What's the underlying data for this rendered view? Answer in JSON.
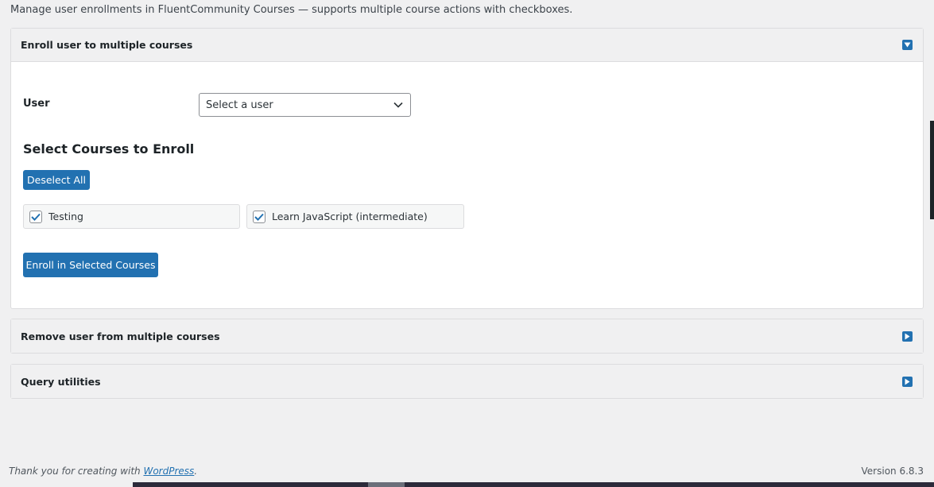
{
  "intro_text": "Manage user enrollments in FluentCommunity Courses — supports multiple course actions with checkboxes.",
  "panels": {
    "enroll": {
      "title": "Enroll user to multiple courses",
      "user_label": "User",
      "user_select_value": "Select a user",
      "section_heading": "Select Courses to Enroll",
      "deselect_label": "Deselect All",
      "courses": [
        {
          "label": "Testing",
          "checked": true
        },
        {
          "label": "Learn JavaScript (intermediate)",
          "checked": true
        }
      ],
      "submit_label": "Enroll in Selected Courses"
    },
    "remove": {
      "title": "Remove user from multiple courses"
    },
    "query": {
      "title": "Query utilities"
    }
  },
  "footer": {
    "thanks_prefix": "Thank you for creating with ",
    "thanks_link": "WordPress",
    "thanks_suffix": ".",
    "version": "Version 6.8.3"
  },
  "colors": {
    "accent": "#2271b1",
    "background": "#f0f0f1",
    "border": "#dcdcde"
  },
  "icons": {
    "expanded": "triangle-down-icon",
    "collapsed": "triangle-right-icon",
    "dropdown": "chevron-down-icon",
    "checkbox": "checkmark-icon"
  }
}
